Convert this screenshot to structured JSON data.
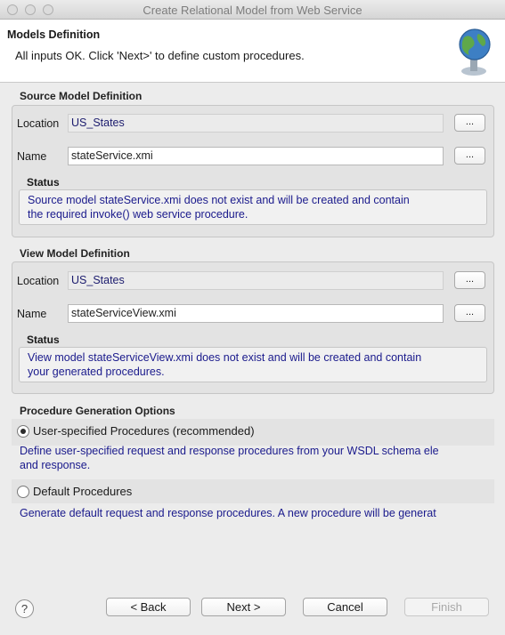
{
  "window": {
    "title": "Create Relational Model from Web Service"
  },
  "header": {
    "title": "Models Definition",
    "message": "All inputs OK. Click 'Next>' to define custom procedures."
  },
  "source": {
    "group_title": "Source Model Definition",
    "location_label": "Location",
    "location_value": "US_States",
    "name_label": "Name",
    "name_value": "stateService.xmi",
    "browse_label": "...",
    "status_title": "Status",
    "status_line1": "Source model stateService.xmi does not exist and will be created and contain",
    "status_line2": "the required invoke() web service procedure."
  },
  "view": {
    "group_title": "View Model Definition",
    "location_label": "Location",
    "location_value": "US_States",
    "name_label": "Name",
    "name_value": "stateServiceView.xmi",
    "browse_label": "...",
    "status_title": "Status",
    "status_line1": "View model stateServiceView.xmi does not exist and will be created and contain",
    "status_line2": "your generated procedures."
  },
  "options": {
    "group_title": "Procedure Generation Options",
    "user": {
      "label": "User-specified Procedures (recommended)",
      "desc1": "Define user-specified request and response procedures from your WSDL schema ele",
      "desc2": "and response.",
      "selected": true
    },
    "default": {
      "label": "Default Procedures",
      "desc1": "Generate default request and response procedures. A new procedure will be generat",
      "selected": false
    }
  },
  "buttons": {
    "help": "?",
    "back": "< Back",
    "next": "Next >",
    "cancel": "Cancel",
    "finish": "Finish"
  }
}
